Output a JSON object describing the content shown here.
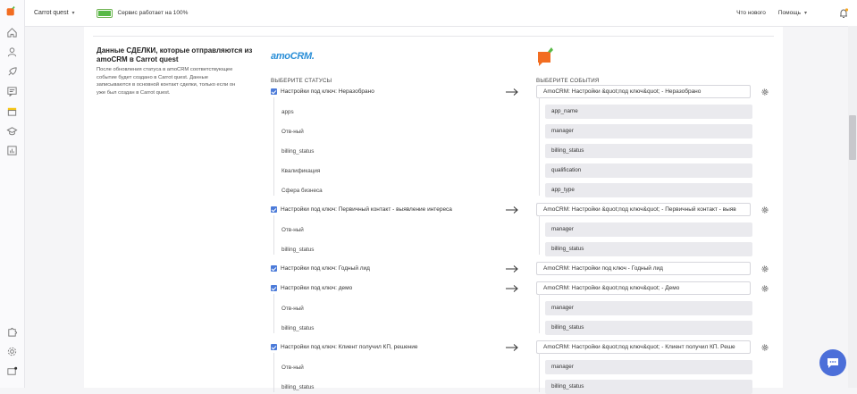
{
  "topbar": {
    "project_name": "Carrot quest",
    "service_status": "Сервис работает на 100%",
    "whats_new": "Что нового",
    "help": "Помощь"
  },
  "colors": {
    "accent": "#4c7bd9",
    "brand": "#f26d21",
    "status_ok": "#58b947"
  },
  "service_level_percent": 100,
  "section": {
    "title": "Данные СДЕЛКИ, которые отправляются из amoCRM в Carrot quest",
    "description": "После обновления статуса в amoCRM соответствующее событие будет создано в Carrot quest. Данные записываются в основной контакт сделки, только если он уже был создан в Carrot quest.",
    "amocrm_logo_text": "amoCRM.",
    "statuses_header": "ВЫБЕРИТЕ СТАТУСЫ",
    "events_header": "ВЫБЕРИТЕ СОБЫТИЯ"
  },
  "rows": [
    {
      "status": "Настройки под ключ: Неразобрано",
      "event": "AmoCRM: Настройки &quot;под ключ&quot; - Неразобрано",
      "props": [
        {
          "label": "apps",
          "value": "app_name"
        },
        {
          "label": "Отв-ный",
          "value": "manager"
        },
        {
          "label": "billing_status",
          "value": "billing_status"
        },
        {
          "label": "Квалификация",
          "value": "qualification"
        },
        {
          "label": "Сфера бизнеса",
          "value": "app_type"
        }
      ]
    },
    {
      "status": "Настройки под ключ: Первичный контакт - выявление интереса",
      "event": "AmoCRM: Настройки &quot;под ключ&quot; - Первичный контакт - выяв",
      "props": [
        {
          "label": "Отв-ный",
          "value": "manager"
        },
        {
          "label": "billing_status",
          "value": "billing_status"
        }
      ]
    },
    {
      "status": "Настройки под ключ: Годный лид",
      "event": "AmoCRM: Настройки под ключ - Годный лид",
      "props": []
    },
    {
      "status": "Настройки под ключ: демо",
      "event": "AmoCRM: Настройки &quot;под ключ&quot; - Демо",
      "props": [
        {
          "label": "Отв-ный",
          "value": "manager"
        },
        {
          "label": "billing_status",
          "value": "billing_status"
        }
      ]
    },
    {
      "status": "Настройки под ключ: Клиент получил КП, решение",
      "event": "AmoCRM: Настройки &quot;под ключ&quot; - Клиент получил КП. Реше",
      "props": [
        {
          "label": "Отв-ный",
          "value": "manager"
        },
        {
          "label": "billing_status",
          "value": "billing_status"
        }
      ]
    }
  ],
  "rail_icons": [
    "home-icon",
    "users-icon",
    "rocket-icon",
    "chat-list-icon",
    "store-icon",
    "graduation-icon",
    "reports-icon",
    "puzzle-icon",
    "settings-icon",
    "billing-icon"
  ]
}
